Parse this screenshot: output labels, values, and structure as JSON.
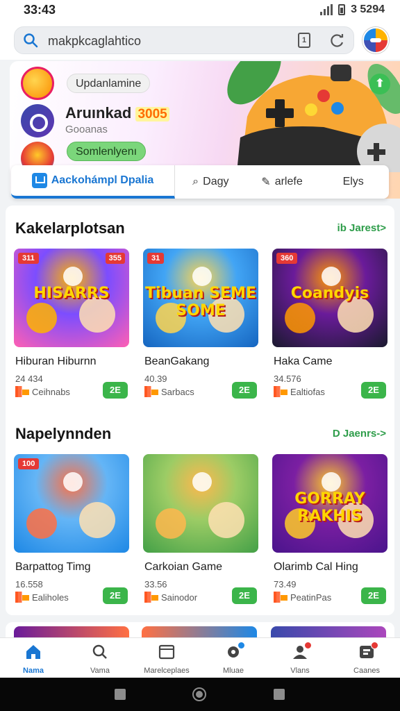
{
  "status_bar": {
    "time": "33:43",
    "battery_text": "3 5294"
  },
  "search": {
    "query": "makpkcaglahtico"
  },
  "hero": {
    "chip_top": "Updanlamine",
    "title": "Aruınkad",
    "title_badge": "3005",
    "subtitle": "Gooanas",
    "chip_green": "Somlenlyenı"
  },
  "tabs": [
    {
      "label": "Aackohámpl Dpalia",
      "icon": "store-icon"
    },
    {
      "label": "Dagy",
      "icon": "search-icon"
    },
    {
      "label": "arlefe",
      "icon": "pen-icon"
    },
    {
      "label": "Elys",
      "icon": "list-icon"
    }
  ],
  "sections": [
    {
      "title": "Kakelarplotsan",
      "see_all": "ib Jarest>",
      "games": [
        {
          "name": "Hiburan Hiburnn",
          "size": "24 434",
          "category": "Ceihnabs",
          "install": "2E",
          "tag": "311",
          "tag2": "355",
          "art_text": "HISARRS",
          "colors": [
            "#ff5fb3",
            "#7c4dff",
            "#ffb300"
          ]
        },
        {
          "name": "BeanGakang",
          "size": "40.39",
          "category": "Sarbacs",
          "install": "2E",
          "tag": "31",
          "tag2": "",
          "art_text": "Tibuan SEME SOME",
          "colors": [
            "#1565c0",
            "#42a5f5",
            "#ffd54f"
          ]
        },
        {
          "name": "Haka Came",
          "size": "34.576",
          "category": "Ealtiofas",
          "install": "2E",
          "tag": "360",
          "tag2": "",
          "art_text": "Coandyis",
          "colors": [
            "#1a1a2e",
            "#6a1b9a",
            "#ff9800"
          ]
        }
      ]
    },
    {
      "title": "Napelynnden",
      "see_all": "D Jaenrs->",
      "games": [
        {
          "name": "Barpattog Timg",
          "size": "16.558",
          "category": "Ealiholes",
          "install": "2E",
          "tag": "100",
          "tag2": "",
          "art_text": "",
          "colors": [
            "#1e88e5",
            "#64b5f6",
            "#ff7043"
          ]
        },
        {
          "name": "Carkoian Game",
          "size": "33.56",
          "category": "Sainodor",
          "install": "2E",
          "tag": "",
          "tag2": "",
          "art_text": "",
          "colors": [
            "#43a047",
            "#9ccc65",
            "#ffb74d"
          ]
        },
        {
          "name": "Olarimb Cal Hing",
          "size": "73.49",
          "category": "PeatinPas",
          "install": "2E",
          "tag": "",
          "tag2": "",
          "art_text": "GORRAY RAKHIS",
          "colors": [
            "#4a148c",
            "#7b1fa2",
            "#ffca28"
          ]
        }
      ]
    }
  ],
  "bottom_nav": [
    {
      "label": "Nama",
      "icon": "home-icon",
      "active": true,
      "dot": ""
    },
    {
      "label": "Vama",
      "icon": "search-icon",
      "active": false,
      "dot": ""
    },
    {
      "label": "Marelceplaes",
      "icon": "library-icon",
      "active": false,
      "dot": ""
    },
    {
      "label": "Mluae",
      "icon": "settings-icon",
      "active": false,
      "dot": "#1e88e5"
    },
    {
      "label": "Vlans",
      "icon": "profile-icon",
      "active": false,
      "dot": "#e53935"
    },
    {
      "label": "Caanes",
      "icon": "games-icon",
      "active": false,
      "dot": "#e53935"
    }
  ],
  "colors": {
    "accent": "#1976d2",
    "install_green": "#3bb54a",
    "see_all_green": "#2e9d4a"
  }
}
